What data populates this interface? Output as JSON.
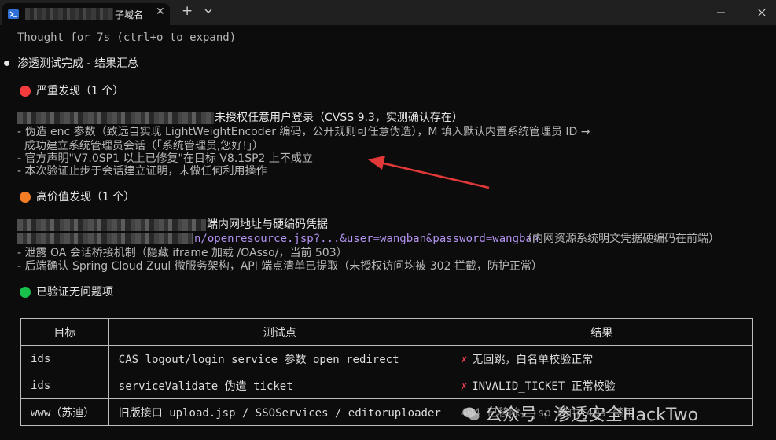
{
  "tab": {
    "title": "子域名",
    "close": "✕",
    "new_tab": "+"
  },
  "window": {
    "minimize": "—",
    "maximize": "☐",
    "close": "✕"
  },
  "thought_line": "Thought for 7s (ctrl+o to expand)",
  "heading": "渗透测试完成 - 结果汇总",
  "severe": {
    "label": "严重发现（1 个）",
    "finding_title": "未授权任意用户登录（CVSS 9.3，实测确认存在）",
    "items": [
      "- 伪造 enc 参数（致远自实现 LightWeightEncoder 编码，公开规则可任意伪造），M 填入默认内置系统管理员 ID →",
      "  成功建立系统管理员会话（「系统管理员,您好!」）",
      "- 官方声明\"V7.0SP1 以上已修复\"在目标 V8.1SP2 上不成立",
      "- 本次验证止步于会话建立证明，未做任何利用操作"
    ]
  },
  "high": {
    "label": "高价值发现（1 个）",
    "finding_title": "端内网地址与硬编码凭据",
    "url_fragment": "n/openresource.jsp?...&user=wangban&password=wangban",
    "url_note": "（内网资源系统明文凭据硬编码在前端）",
    "items": [
      "- 泄露 OA 会话桥接机制（隐藏 iframe 加载 /OAsso/，当前 503）",
      "- 后端确认 Spring Cloud Zuul 微服务架构，API 端点清单已提取（未授权访问均被 302 拦截，防护正常）"
    ]
  },
  "verified": {
    "label": "已验证无问题项"
  },
  "table": {
    "headers": [
      "目标",
      "测试点",
      "结果"
    ],
    "rows": [
      [
        "ids",
        "CAS logout/login service 参数 open redirect",
        "无回跳，白名单校验正常"
      ],
      [
        "ids",
        "serviceValidate 伪造 ticket",
        "INVALID_TICKET 正常校验"
      ],
      [
        "www（苏迪）",
        "旧版接口 upload.jsp / SSOServices / editoruploader",
        "404 已移除，jsp 路由 403 禁用"
      ]
    ]
  },
  "watermark": "公众号 · 渗透安全HackTwo",
  "colors": {
    "severe": "#f53b3b",
    "high": "#f47c25",
    "verified": "#19c24a",
    "arrow": "#e23838"
  }
}
